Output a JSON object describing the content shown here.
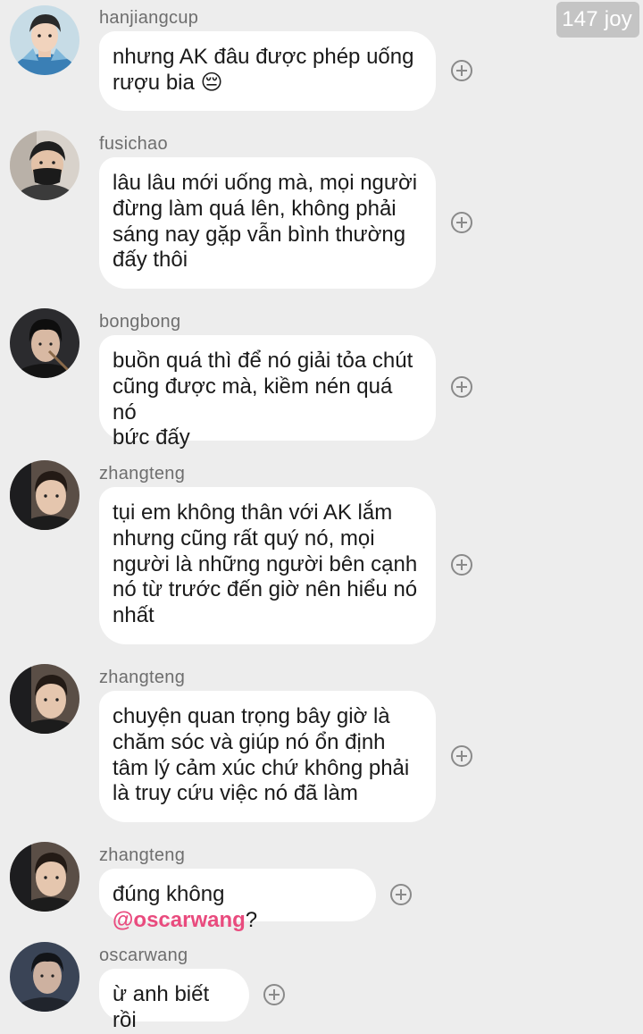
{
  "watermark": {
    "text": "147 joy"
  },
  "messages": [
    {
      "username": "hanjiangcup",
      "text": "nhưng AK đâu được phép uống\nrượu bia 😔",
      "avatar_icon": "avatar-hanjiangcup-icon"
    },
    {
      "username": "fusichao",
      "text": "lâu lâu mới uống mà, mọi người\nđừng làm quá lên, không phải\nsáng nay gặp vẫn bình thường\nđấy thôi",
      "avatar_icon": "avatar-fusichao-icon"
    },
    {
      "username": "bongbong",
      "text": "buồn quá thì để nó giải tỏa chút\ncũng được mà, kiềm nén quá nó\nbức đấy",
      "avatar_icon": "avatar-bongbong-icon"
    },
    {
      "username": "zhangteng",
      "text": "tụi em không thân với AK lắm\nnhưng cũng rất quý nó, mọi\nngười là những người bên cạnh\nnó từ trước đến giờ nên hiểu nó\nnhất",
      "avatar_icon": "avatar-zhangteng-icon"
    },
    {
      "username": "zhangteng",
      "text": "chuyện quan trọng bây giờ là\nchăm sóc và giúp nó ổn định\ntâm lý cảm xúc chứ không phải\nlà truy cứu việc nó đã làm",
      "avatar_icon": "avatar-zhangteng-icon"
    },
    {
      "username": "zhangteng",
      "text_before": "đúng không ",
      "mention": "@oscarwang",
      "text_after": "?",
      "avatar_icon": "avatar-zhangteng-icon"
    },
    {
      "username": "oscarwang",
      "text": "ừ anh biết rồi",
      "avatar_icon": "avatar-oscarwang-icon"
    }
  ],
  "colors": {
    "background": "#ededed",
    "bubble": "#ffffff",
    "mention": "#e94b7e",
    "username": "#6e6e6e",
    "watermark_bg": "#c4c4c4"
  },
  "icons": {
    "add_reaction": "plus-circle-icon"
  }
}
